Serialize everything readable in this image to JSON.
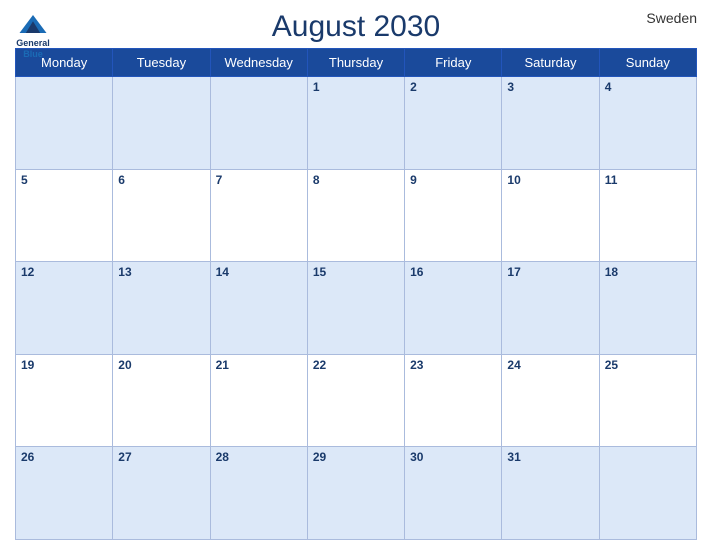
{
  "header": {
    "title": "August 2030",
    "country": "Sweden",
    "logo_general": "General",
    "logo_blue": "Blue"
  },
  "weekdays": [
    "Monday",
    "Tuesday",
    "Wednesday",
    "Thursday",
    "Friday",
    "Saturday",
    "Sunday"
  ],
  "weeks": [
    [
      null,
      null,
      null,
      1,
      2,
      3,
      4
    ],
    [
      5,
      6,
      7,
      8,
      9,
      10,
      11
    ],
    [
      12,
      13,
      14,
      15,
      16,
      17,
      18
    ],
    [
      19,
      20,
      21,
      22,
      23,
      24,
      25
    ],
    [
      26,
      27,
      28,
      29,
      30,
      31,
      null
    ]
  ]
}
